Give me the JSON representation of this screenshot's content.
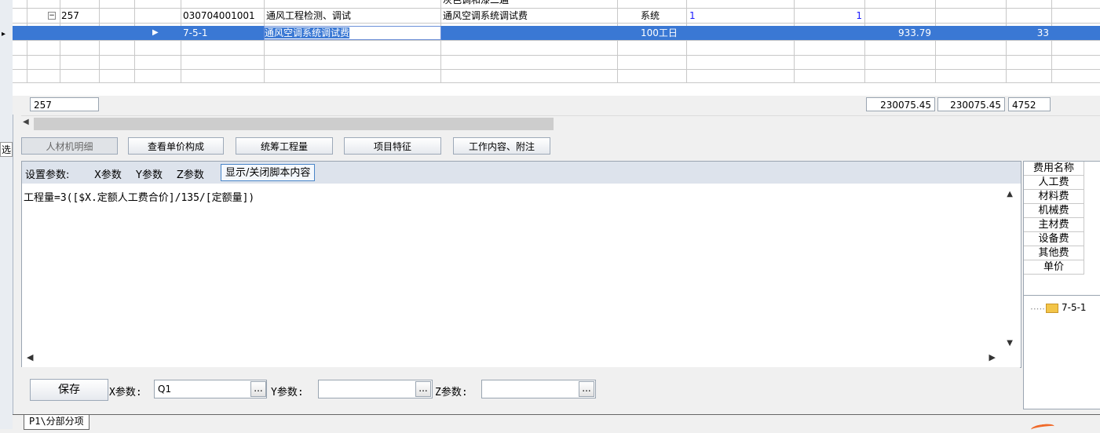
{
  "grid": {
    "rows": [
      {
        "id": "257",
        "code": "030704001001",
        "name": "通风工程检测、调试",
        "desc": "通风空调系统调试费",
        "unit": "系统",
        "qty": "1",
        "qty2": "1"
      },
      {
        "code": "7-5-1",
        "name": "通风空调系统调试费",
        "unit": "100工日",
        "price": "933.79",
        "extra": "33"
      }
    ],
    "partial_top_text": "灰色调和漆二遍"
  },
  "summary": {
    "id": "257",
    "v1": "230075.45",
    "v2": "230075.45",
    "v3": "4752"
  },
  "left_gutter": {
    "sel_label": "选"
  },
  "tabs": [
    "人材机明细",
    "查看单价构成",
    "统筹工程量",
    "项目特征",
    "工作内容、附注"
  ],
  "editor": {
    "toolbar_label": "设置参数:",
    "x_param": "X参数",
    "y_param": "Y参数",
    "z_param": "Z参数",
    "toggle_script": "显示/关闭脚本内容",
    "formula": "工程量=3([$X.定额人工费合价]/135/[定额量])"
  },
  "params": {
    "save": "保存",
    "x_label": "X参数:",
    "x_value": "Q1",
    "y_label": "Y参数:",
    "y_value": "",
    "z_label": "Z参数:",
    "z_value": "",
    "browse": "..."
  },
  "fee_panel": {
    "header": "费用名称",
    "items": [
      "人工费",
      "材料费",
      "机械费",
      "主材费",
      "设备费",
      "其他费",
      "单价"
    ],
    "tree_item": "7-5-1"
  },
  "bottom": {
    "sheet_tab": "P1\\分部分项"
  }
}
